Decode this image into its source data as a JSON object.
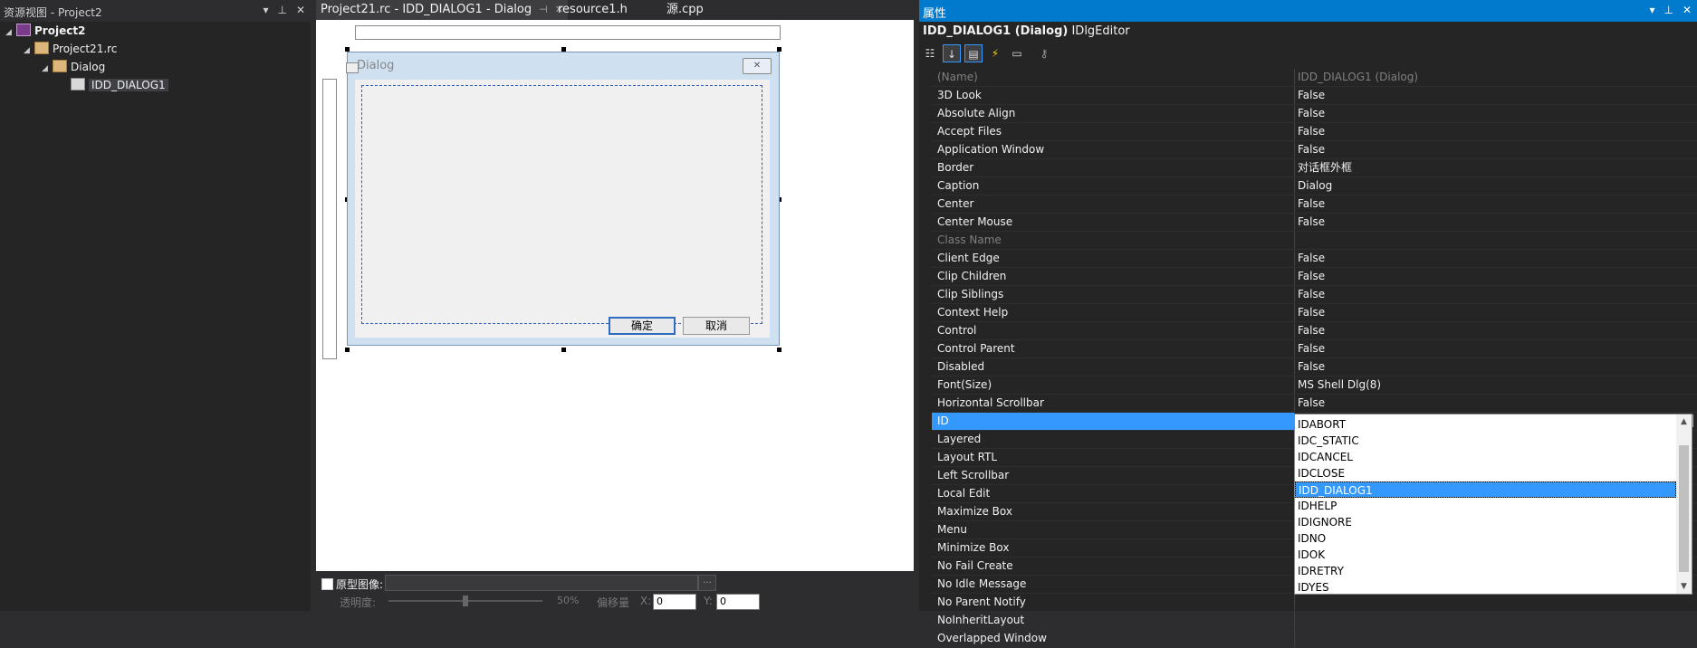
{
  "resource_view": {
    "title": "资源视图 - Project2",
    "tree": {
      "project": "Project2",
      "rc_file": "Project21.rc",
      "folder": "Dialog",
      "dialog": "IDD_DIALOG1"
    }
  },
  "editor": {
    "tabs": [
      {
        "label": "Project21.rc - IDD_DIALOG1 - Dialog"
      },
      {
        "label": "resource1.h"
      },
      {
        "label": "源.cpp"
      }
    ],
    "dialog": {
      "caption": "Dialog",
      "ok_label": "确定",
      "cancel_label": "取消"
    },
    "bottom": {
      "proto_image_label": "原型图像:",
      "browse_label": "...",
      "transparency_label": "透明度:",
      "transparency_value": "50%",
      "transparency_level": 0.5,
      "offset_label": "偏移量",
      "x_label": "X:",
      "x_value": "0",
      "y_label": "Y:",
      "y_value": "0"
    }
  },
  "properties": {
    "title": "属性",
    "object_name": "IDD_DIALOG1 (Dialog)",
    "object_type": "IDlgEditor",
    "rows": [
      {
        "name": "(Name)",
        "value": "IDD_DIALOG1 (Dialog)",
        "disabled": true
      },
      {
        "name": "3D Look",
        "value": "False"
      },
      {
        "name": "Absolute Align",
        "value": "False"
      },
      {
        "name": "Accept Files",
        "value": "False"
      },
      {
        "name": "Application Window",
        "value": "False"
      },
      {
        "name": "Border",
        "value": "对话框外框"
      },
      {
        "name": "Caption",
        "value": "Dialog"
      },
      {
        "name": "Center",
        "value": "False"
      },
      {
        "name": "Center Mouse",
        "value": "False"
      },
      {
        "name": "Class Name",
        "value": "",
        "disabled": true
      },
      {
        "name": "Client Edge",
        "value": "False"
      },
      {
        "name": "Clip Children",
        "value": "False"
      },
      {
        "name": "Clip Siblings",
        "value": "False"
      },
      {
        "name": "Context Help",
        "value": "False"
      },
      {
        "name": "Control",
        "value": "False"
      },
      {
        "name": "Control Parent",
        "value": "False"
      },
      {
        "name": "Disabled",
        "value": "False"
      },
      {
        "name": "Font(Size)",
        "value": "MS Shell Dlg(8)"
      },
      {
        "name": "Horizontal Scrollbar",
        "value": "False"
      },
      {
        "name": "ID",
        "value": "IDD_DIALOG1",
        "selected": true
      },
      {
        "name": "Layered",
        "value": ""
      },
      {
        "name": "Layout RTL",
        "value": ""
      },
      {
        "name": "Left Scrollbar",
        "value": ""
      },
      {
        "name": "Local Edit",
        "value": ""
      },
      {
        "name": "Maximize Box",
        "value": ""
      },
      {
        "name": "Menu",
        "value": ""
      },
      {
        "name": "Minimize Box",
        "value": ""
      },
      {
        "name": "No Fail Create",
        "value": ""
      },
      {
        "name": "No Idle Message",
        "value": ""
      },
      {
        "name": "No Parent Notify",
        "value": ""
      },
      {
        "name": "NoInheritLayout",
        "value": ""
      },
      {
        "name": "Overlapped Window",
        "value": ""
      }
    ],
    "id_dropdown": {
      "options": [
        "IDABORT",
        "IDC_STATIC",
        "IDCANCEL",
        "IDCLOSE",
        "IDD_DIALOG1",
        "IDHELP",
        "IDIGNORE",
        "IDNO",
        "IDOK",
        "IDRETRY",
        "IDYES"
      ],
      "selected": "IDD_DIALOG1"
    }
  }
}
